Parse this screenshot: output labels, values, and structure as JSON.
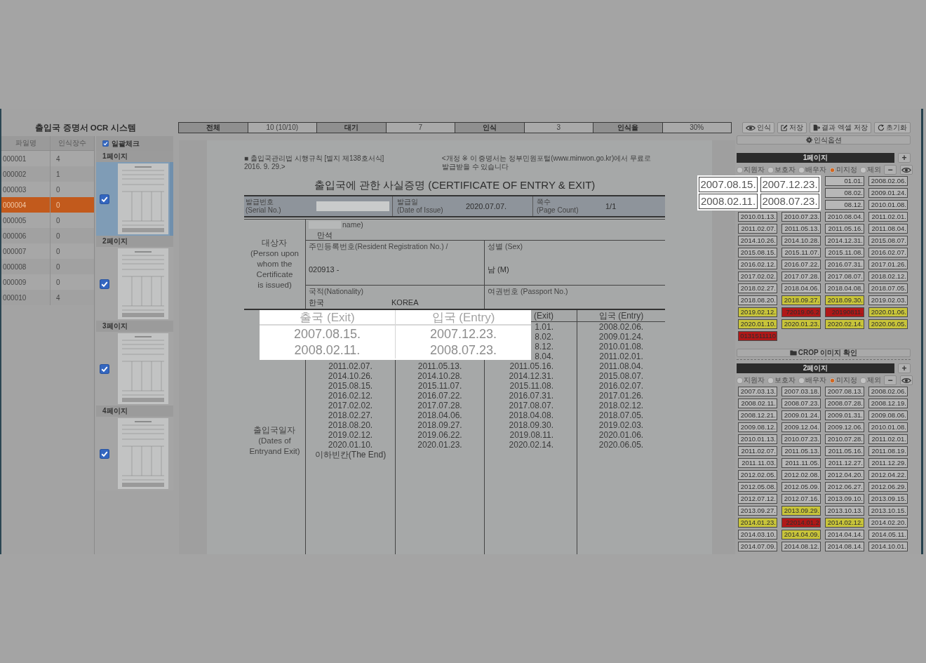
{
  "app_title": "출입국 증명서 OCR 시스템",
  "file_table": {
    "columns": [
      "파일명",
      "인식장수"
    ],
    "rows": [
      {
        "file": "000001",
        "count": "4",
        "selected": false
      },
      {
        "file": "000002",
        "count": "1",
        "selected": false
      },
      {
        "file": "000003",
        "count": "0",
        "selected": false
      },
      {
        "file": "000004",
        "count": "0",
        "selected": true
      },
      {
        "file": "000005",
        "count": "0",
        "selected": false
      },
      {
        "file": "000006",
        "count": "0",
        "selected": false
      },
      {
        "file": "000007",
        "count": "0",
        "selected": false
      },
      {
        "file": "000008",
        "count": "0",
        "selected": false
      },
      {
        "file": "000009",
        "count": "0",
        "selected": false
      },
      {
        "file": "000010",
        "count": "4",
        "selected": false
      }
    ]
  },
  "page_list": {
    "check_all": {
      "label": "일괄체크",
      "checked": true
    },
    "pages": [
      {
        "label": "1페이지",
        "checked": true,
        "selected": true
      },
      {
        "label": "2페이지",
        "checked": true,
        "selected": false
      },
      {
        "label": "3페이지",
        "checked": true,
        "selected": false
      },
      {
        "label": "4페이지",
        "checked": true,
        "selected": false
      }
    ]
  },
  "stats": [
    {
      "label": "전체",
      "value": "10 (10/10)"
    },
    {
      "label": "대기",
      "value": "7"
    },
    {
      "label": "인식",
      "value": "3"
    },
    {
      "label": "인식율",
      "value": "30%"
    }
  ],
  "toolbar": [
    {
      "kind": "recognize",
      "label": "인식"
    },
    {
      "kind": "save",
      "label": "저장"
    },
    {
      "kind": "export",
      "label": "결과 엑셀 저장"
    },
    {
      "kind": "reset",
      "label": "초기화"
    }
  ],
  "options_button": {
    "label": "인식옵션"
  },
  "document": {
    "form_reference": "■ 출입국관리법 시행규칙 [별지 제138호서식]",
    "revision": "2016. 9. 29.>",
    "notice": "<개정 ※ 이 증명서는 정부민원포털(www.minwon.go.kr)에서 무료로\n발급받을 수 있습니다",
    "title": "출입국에 관한 사실증명 (CERTIFICATE OF ENTRY & EXIT)",
    "issue_info": [
      {
        "label": "발급번호\n(Serial No.)",
        "redacted": true
      },
      {
        "label": "발급일\n(Date of Issue)",
        "value": "2020.07.07.",
        "redacted": false
      },
      {
        "label": "쪽수\n(Page Count)",
        "value": "1/1",
        "redacted": false
      }
    ],
    "subject_label": "대상자\n(Person upon\nwhom the\nCertificate\nis issued)",
    "name_field": {
      "label": "name)",
      "value": "만석",
      "redacted": true
    },
    "resident_number": {
      "label": "주민등록번호(Resident Registration No.) /",
      "value": "020913 -"
    },
    "sex": {
      "label": "성별 (Sex)",
      "value": "남 (M)"
    },
    "nationality": {
      "label": "국적(Nationality)",
      "value": "한국",
      "value_english": "KOREA"
    },
    "passport": {
      "label": "여권번호 (Passport No.)"
    },
    "dates_label": "출입국일자\n(Dates of\nEntryand Exit)",
    "dates_table": {
      "header": {
        "exit_2": "(Exit)",
        "entry_2": "입국 (Entry)"
      },
      "rows": [
        {
          "exit_2": "1.01.",
          "entry_2": "2008.02.06."
        },
        {
          "exit_2": "8.02.",
          "entry_2": "2009.01.24."
        },
        {
          "exit_2": "8.12.",
          "entry_2": "2010.01.08."
        },
        {
          "exit_2": "8.04.",
          "entry_2": "2011.02.01."
        },
        {
          "exit_1": "2011.02.07.",
          "entry_1": "2011.05.13.",
          "exit_2": "2011.05.16.",
          "entry_2": "2011.08.04."
        },
        {
          "exit_1": "2014.10.26.",
          "entry_1": "2014.10.28.",
          "exit_2": "2014.12.31.",
          "entry_2": "2015.08.07."
        },
        {
          "exit_1": "2015.08.15.",
          "entry_1": "2015.11.07.",
          "exit_2": "2015.11.08.",
          "entry_2": "2016.02.07."
        },
        {
          "exit_1": "2016.02.12.",
          "entry_1": "2016.07.22.",
          "exit_2": "2016.07.31.",
          "entry_2": "2017.01.26."
        },
        {
          "exit_1": "2017.02.02.",
          "entry_1": "2017.07.28.",
          "exit_2": "2017.08.07.",
          "entry_2": "2018.02.12."
        },
        {
          "exit_1": "2018.02.27.",
          "entry_1": "2018.04.06.",
          "exit_2": "2018.04.08.",
          "entry_2": "2018.07.05."
        },
        {
          "exit_1": "2018.08.20.",
          "entry_1": "2018.09.27.",
          "exit_2": "2018.09.30.",
          "entry_2": "2019.02.03."
        },
        {
          "exit_1": "2019.02.12.",
          "entry_1": "2019.06.22.",
          "exit_2": "2019.08.11.",
          "entry_2": "2020.01.06."
        },
        {
          "exit_1": "2020.01.10.",
          "entry_1": "2020.01.23.",
          "exit_2": "2020.02.14.",
          "entry_2": "2020.06.05."
        },
        {
          "exit_1": "이하빈칸(The End)"
        }
      ]
    }
  },
  "crop_preview": {
    "columns": [
      "출국 (Exit)",
      "입국 (Entry)"
    ],
    "rows": [
      [
        "2007.08.15.",
        "2007.12.23."
      ],
      [
        "2008.02.11.",
        "2008.07.23."
      ]
    ]
  },
  "result_pages": [
    {
      "title": "1페이지",
      "add_label": "+",
      "remove_label": "−",
      "roles": [
        {
          "label": "지원자",
          "selected": false
        },
        {
          "label": "보호자",
          "selected": false
        },
        {
          "label": "배우자",
          "selected": false
        },
        {
          "label": "미지정",
          "selected": true
        },
        {
          "label": "제외",
          "selected": false
        }
      ],
      "highlight": [
        "2007.08.15.",
        "2007.12.23.",
        "2008.02.11.",
        "2008.07.23."
      ],
      "cells": [
        {
          "text": "01.01.",
          "color": "#b7b7b7"
        },
        {
          "text": "2008.02.06.",
          "color": "#b7b7b7"
        },
        {
          "text": "08.02.",
          "color": "#b7b7b7"
        },
        {
          "text": "2009.01.24.",
          "color": "#b7b7b7"
        },
        {
          "text": "08.12.",
          "color": "#b7b7b7"
        },
        {
          "text": "2010.01.08.",
          "color": "#b7b7b7"
        },
        {
          "text": "2010.01.13.",
          "color": "#b7b7b7"
        },
        {
          "text": "2010.07.23.",
          "color": "#b7b7b7"
        },
        {
          "text": "2010.08.04.",
          "color": "#b7b7b7"
        },
        {
          "text": "2011.02.01.",
          "color": "#b7b7b7"
        },
        {
          "text": "2011.02.07.",
          "color": "#b7b7b7"
        },
        {
          "text": "2011.05.13.",
          "color": "#b7b7b7"
        },
        {
          "text": "2011.05.16.",
          "color": "#b7b7b7"
        },
        {
          "text": "2011.08.04.",
          "color": "#b7b7b7"
        },
        {
          "text": "2014.10.26.",
          "color": "#b7b7b7"
        },
        {
          "text": "2014.10.28.",
          "color": "#b7b7b7"
        },
        {
          "text": "2014.12.31.",
          "color": "#b7b7b7"
        },
        {
          "text": "2015.08.07.",
          "color": "#b7b7b7"
        },
        {
          "text": "2015.08.15.",
          "color": "#b7b7b7"
        },
        {
          "text": "2015.11.07.",
          "color": "#b7b7b7"
        },
        {
          "text": "2015.11.08.",
          "color": "#b7b7b7"
        },
        {
          "text": "2016.02.07.",
          "color": "#b7b7b7"
        },
        {
          "text": "2016.02.12.",
          "color": "#b7b7b7"
        },
        {
          "text": "2016.07.22.",
          "color": "#b7b7b7"
        },
        {
          "text": "2016.07.31.",
          "color": "#b7b7b7"
        },
        {
          "text": "2017.01.26.",
          "color": "#b7b7b7"
        },
        {
          "text": "2017.02.02.",
          "color": "#b7b7b7"
        },
        {
          "text": "2017.07.28.",
          "color": "#b7b7b7"
        },
        {
          "text": "2017.08.07.",
          "color": "#b7b7b7"
        },
        {
          "text": "2018.02.12.",
          "color": "#b7b7b7"
        },
        {
          "text": "2018.02.27.",
          "color": "#b7b7b7"
        },
        {
          "text": "2018.04.06.",
          "color": "#b7b7b7"
        },
        {
          "text": "2018.04.08.",
          "color": "#b7b7b7"
        },
        {
          "text": "2018.07.05.",
          "color": "#b7b7b7"
        },
        {
          "text": "2018.08.20.",
          "color": "#b7b7b7"
        },
        {
          "text": "2018.09.27.",
          "color": "#c8c43a"
        },
        {
          "text": "2018.09.30.",
          "color": "#c8c43a"
        },
        {
          "text": "2019.02.03.",
          "color": "#b7b7b7"
        },
        {
          "text": "2019.02.12.",
          "color": "#c8c43a"
        },
        {
          "text": "72019.06.2",
          "color": "#b01818"
        },
        {
          "text": "20190811.",
          "color": "#b01818"
        },
        {
          "text": "2020.01.06.",
          "color": "#c8c43a"
        },
        {
          "text": "2020.01.10.",
          "color": "#c8c43a"
        },
        {
          "text": "2020.01.23.",
          "color": "#c8c43a"
        },
        {
          "text": "2020.02.14.",
          "color": "#c8c43a"
        },
        {
          "text": "2020.06.05.",
          "color": "#c8c43a"
        },
        {
          "text": "0131511110",
          "color": "#b01818"
        }
      ],
      "crop_button": {
        "label": "CROP 이미지 확인"
      }
    },
    {
      "title": "2페이지",
      "add_label": "+",
      "remove_label": "−",
      "roles": [
        {
          "label": "지원자",
          "selected": false
        },
        {
          "label": "보호자",
          "selected": false
        },
        {
          "label": "배우자",
          "selected": false
        },
        {
          "label": "미지정",
          "selected": true
        },
        {
          "label": "제외",
          "selected": false
        }
      ],
      "cells": [
        {
          "text": "2007.03.13.",
          "color": "#b7b7b7"
        },
        {
          "text": "2007.03.18.",
          "color": "#b7b7b7"
        },
        {
          "text": "2007.08.13.",
          "color": "#b7b7b7"
        },
        {
          "text": "2008.02.06.",
          "color": "#b7b7b7"
        },
        {
          "text": "2008.02.11.",
          "color": "#b7b7b7"
        },
        {
          "text": "2008.07.23.",
          "color": "#b7b7b7"
        },
        {
          "text": "2008.07.28.",
          "color": "#b7b7b7"
        },
        {
          "text": "2008.12.19.",
          "color": "#b7b7b7"
        },
        {
          "text": "2008.12.21.",
          "color": "#b7b7b7"
        },
        {
          "text": "2009.01.24.",
          "color": "#b7b7b7"
        },
        {
          "text": "2009.01.31.",
          "color": "#b7b7b7"
        },
        {
          "text": "2009.08.06.",
          "color": "#b7b7b7"
        },
        {
          "text": "2009.08.12.",
          "color": "#b7b7b7"
        },
        {
          "text": "2009.12.04.",
          "color": "#b7b7b7"
        },
        {
          "text": "2009.12.06.",
          "color": "#b7b7b7"
        },
        {
          "text": "2010.01.08.",
          "color": "#b7b7b7"
        },
        {
          "text": "2010.01.13.",
          "color": "#b7b7b7"
        },
        {
          "text": "2010.07.23.",
          "color": "#b7b7b7"
        },
        {
          "text": "2010.07.28.",
          "color": "#b7b7b7"
        },
        {
          "text": "2011.02.01.",
          "color": "#b7b7b7"
        },
        {
          "text": "2011.02.07.",
          "color": "#b7b7b7"
        },
        {
          "text": "2011.05.13.",
          "color": "#b7b7b7"
        },
        {
          "text": "2011.05.16.",
          "color": "#b7b7b7"
        },
        {
          "text": "2011.08.19.",
          "color": "#b7b7b7"
        },
        {
          "text": "2011.11.03.",
          "color": "#b7b7b7"
        },
        {
          "text": "2011.11.05.",
          "color": "#b7b7b7"
        },
        {
          "text": "2011.12.27.",
          "color": "#b7b7b7"
        },
        {
          "text": "2011.12.29.",
          "color": "#b7b7b7"
        },
        {
          "text": "2012.02.05.",
          "color": "#b7b7b7"
        },
        {
          "text": "2012.02.08.",
          "color": "#b7b7b7"
        },
        {
          "text": "2012.04.20.",
          "color": "#b7b7b7"
        },
        {
          "text": "2012.04.22.",
          "color": "#b7b7b7"
        },
        {
          "text": "2012.05.08.",
          "color": "#b7b7b7"
        },
        {
          "text": "2012.05.09.",
          "color": "#b7b7b7"
        },
        {
          "text": "2012.06.27.",
          "color": "#b7b7b7"
        },
        {
          "text": "2012.06.29.",
          "color": "#b7b7b7"
        },
        {
          "text": "2012.07.12.",
          "color": "#b7b7b7"
        },
        {
          "text": "2012.07.16.",
          "color": "#b7b7b7"
        },
        {
          "text": "2013.09.10.",
          "color": "#b7b7b7"
        },
        {
          "text": "2013.09.15.",
          "color": "#b7b7b7"
        },
        {
          "text": "2013.09.27.",
          "color": "#b7b7b7"
        },
        {
          "text": "2013.09.29.",
          "color": "#c8c43a"
        },
        {
          "text": "2013.10.13.",
          "color": "#b7b7b7"
        },
        {
          "text": "2013.10.15.",
          "color": "#b7b7b7"
        },
        {
          "text": "2014.01.23.",
          "color": "#c8c43a"
        },
        {
          "text": "22014.01.2",
          "color": "#b01818"
        },
        {
          "text": "2014.02.12.",
          "color": "#c8c43a"
        },
        {
          "text": "2014.02.20.",
          "color": "#b7b7b7"
        },
        {
          "text": "2014.03.10.",
          "color": "#b7b7b7"
        },
        {
          "text": "2014.04.09.",
          "color": "#c8c43a"
        },
        {
          "text": "2014.04.14.",
          "color": "#b7b7b7"
        },
        {
          "text": "2014.05.11.",
          "color": "#b7b7b7"
        },
        {
          "text": "2014.07.09.",
          "color": "#b7b7b7"
        },
        {
          "text": "2014.08.12.",
          "color": "#b7b7b7"
        },
        {
          "text": "2014.08.14.",
          "color": "#b7b7b7"
        },
        {
          "text": "2014.10.01.",
          "color": "#b7b7b7"
        }
      ]
    }
  ]
}
